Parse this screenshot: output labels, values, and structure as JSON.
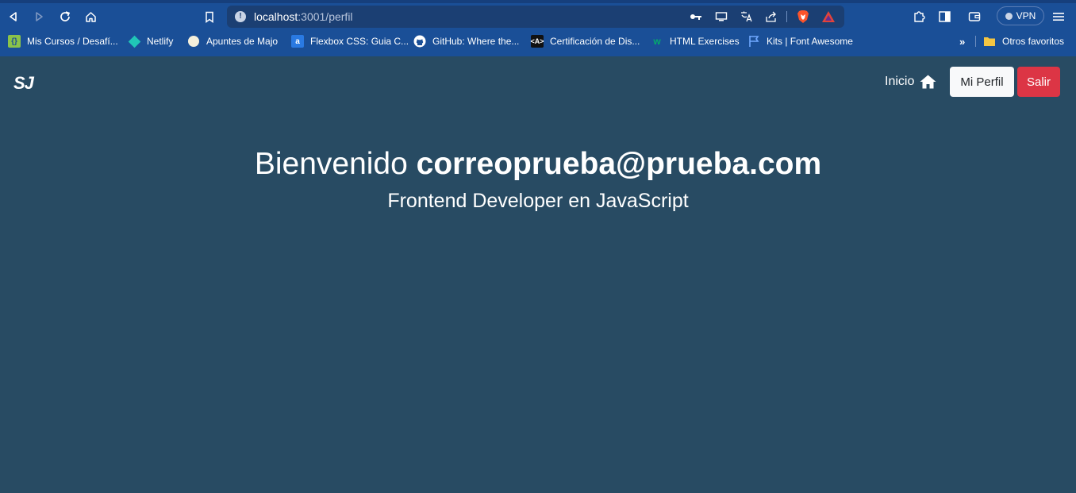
{
  "browser": {
    "url_host": "localhost",
    "url_path": ":3001/perfil",
    "vpn_label": "VPN",
    "bookmarks": [
      {
        "label": "Mis Cursos / Desafí...",
        "icon": "alura-icon",
        "color": "#8bc34a"
      },
      {
        "label": "Netlify",
        "icon": "netlify-icon",
        "color": "#20c6b7"
      },
      {
        "label": "Apuntes de Majo",
        "icon": "circle-icon",
        "color": "#f5f0dc"
      },
      {
        "label": "Flexbox CSS: Guia C...",
        "icon": "flexbox-icon",
        "color": "#2a7ae2"
      },
      {
        "label": "GitHub: Where the...",
        "icon": "github-icon",
        "color": "#ffffff"
      },
      {
        "label": "Certificación de Dis...",
        "icon": "certificacion-icon",
        "color": "#111111"
      },
      {
        "label": "HTML Exercises",
        "icon": "w3schools-icon",
        "color": "#04aa6d"
      },
      {
        "label": "Kits | Font Awesome",
        "icon": "flag-icon",
        "color": "#6fa8ff"
      }
    ],
    "other_favorites": "Otros favoritos"
  },
  "app": {
    "brand": "SJ",
    "nav_home": "Inicio",
    "btn_profile": "Mi Perfil",
    "btn_logout": "Salir",
    "colors": {
      "background": "#284b63",
      "logout": "#dc3545",
      "profile": "#f8f9fa"
    }
  },
  "profile": {
    "greeting": "Bienvenido",
    "email": "correoprueba@prueba.com",
    "role": "Frontend Developer en JavaScript"
  }
}
